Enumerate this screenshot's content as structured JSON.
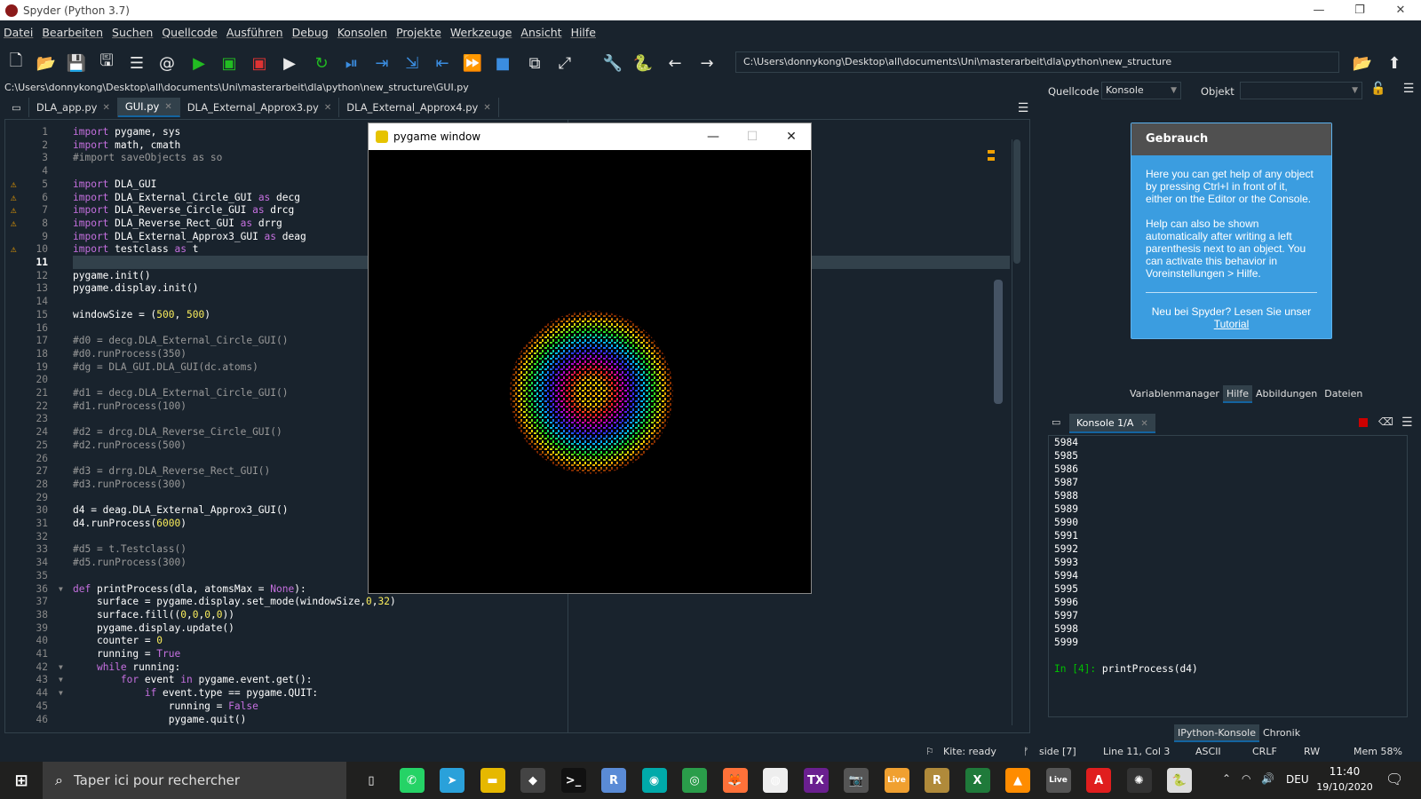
{
  "window": {
    "title": "Spyder (Python 3.7)"
  },
  "menu": [
    "Datei",
    "Bearbeiten",
    "Suchen",
    "Quellcode",
    "Ausführen",
    "Debug",
    "Konsolen",
    "Projekte",
    "Werkzeuge",
    "Ansicht",
    "Hilfe"
  ],
  "toolbar": {
    "path": "C:\\Users\\donnykong\\Desktop\\all\\documents\\Uni\\masterarbeit\\dla\\python\\new_structure"
  },
  "editor": {
    "filepath": "C:\\Users\\donnykong\\Desktop\\all\\documents\\Uni\\masterarbeit\\dla\\python\\new_structure\\GUI.py",
    "tabs": [
      "DLA_app.py",
      "GUI.py",
      "DLA_External_Approx3.py",
      "DLA_External_Approx4.py"
    ],
    "current_line": "11",
    "lines": [
      "import pygame, sys",
      "import math, cmath",
      "#import saveObjects as so",
      "",
      "import DLA_GUI",
      "import DLA_External_Circle_GUI as decg",
      "import DLA_Reverse_Circle_GUI as drcg",
      "import DLA_Reverse_Rect_GUI as drrg",
      "import DLA_External_Approx3_GUI as deag",
      "import testclass as t",
      "",
      "pygame.init()",
      "pygame.display.init()",
      "",
      "windowSize = (500, 500)",
      "",
      "#d0 = decg.DLA_External_Circle_GUI()",
      "#d0.runProcess(350)",
      "#dg = DLA_GUI.DLA_GUI(dc.atoms)",
      "",
      "#d1 = decg.DLA_External_Circle_GUI()",
      "#d1.runProcess(100)",
      "",
      "#d2 = drcg.DLA_Reverse_Circle_GUI()",
      "#d2.runProcess(500)",
      "",
      "#d3 = drrg.DLA_Reverse_Rect_GUI()",
      "#d3.runProcess(300)",
      "",
      "d4 = deag.DLA_External_Approx3_GUI()",
      "d4.runProcess(6000)",
      "",
      "#d5 = t.Testclass()",
      "#d5.runProcess(300)",
      "",
      "def printProcess(dla, atomsMax = None):",
      "    surface = pygame.display.set_mode(windowSize,0,32)",
      "    surface.fill((0,0,0,0))",
      "    pygame.display.update()",
      "    counter = 0",
      "    running = True",
      "    while running:",
      "        for event in pygame.event.get():",
      "            if event.type == pygame.QUIT:",
      "                running = False",
      "                pygame.quit()"
    ]
  },
  "pygame": {
    "title": "pygame window"
  },
  "right_panel": {
    "source_label": "Quellcode",
    "source_value": "Konsole",
    "object_label": "Objekt",
    "help_title": "Gebrauch",
    "help_p1": "Here you can get help of any object by pressing Ctrl+I in front of it, either on the Editor or the Console.",
    "help_p2": "Help can also be shown automatically after writing a left parenthesis next to an object. You can activate this behavior in Voreinstellungen > Hilfe.",
    "help_p3": "Neu bei Spyder? Lesen Sie unser",
    "help_link": "Tutorial",
    "pane_tabs": [
      "Variablenmanager",
      "Hilfe",
      "Abbildungen",
      "Dateien"
    ]
  },
  "console": {
    "tab": "Konsole 1/A",
    "output": [
      "5984",
      "5985",
      "5986",
      "5987",
      "5988",
      "5989",
      "5990",
      "5991",
      "5992",
      "5993",
      "5994",
      "5995",
      "5996",
      "5997",
      "5998",
      "5999"
    ],
    "prompt": "In [4]:",
    "command": "printProcess(d4)",
    "bottom_tabs": [
      "IPython-Konsole",
      "Chronik"
    ]
  },
  "status": {
    "kite": "Kite: ready",
    "branch": "side [7]",
    "position": "Line 11, Col 3",
    "encoding": "ASCII",
    "eol": "CRLF",
    "rw": "RW",
    "mem": "Mem 58%"
  },
  "taskbar": {
    "search_placeholder": "Taper ici pour rechercher",
    "lang": "DEU",
    "time": "11:40",
    "date": "19/10/2020",
    "icons": [
      "task-view-icon",
      "whatsapp-icon",
      "telegram-icon",
      "file-explorer-icon",
      "git-icon",
      "terminal-icon",
      "r-icon",
      "gitkraken-icon",
      "anaconda-icon",
      "firefox-icon",
      "chrome-icon",
      "texstudio-icon",
      "camera-icon",
      "ableton-live-icon",
      "league-icon",
      "excel-icon",
      "vlc-icon",
      "live-icon",
      "pdf-icon",
      "spider-icon",
      "python-icon"
    ]
  }
}
